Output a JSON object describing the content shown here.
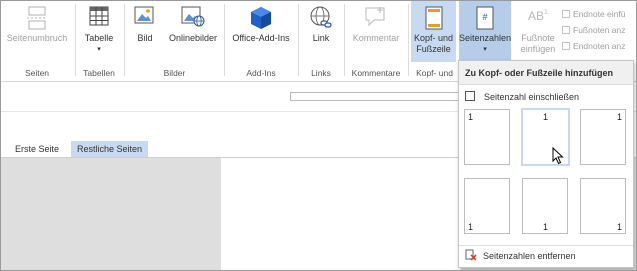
{
  "ribbon": {
    "buttons": {
      "seitenumbruch": "Seitenumbruch",
      "tabelle": "Tabelle",
      "bild": "Bild",
      "onlinebilder": "Onlinebilder",
      "office_addins": "Office-Add-Ins",
      "link": "Link",
      "kommentar": "Kommentar",
      "kopf_line1": "Kopf- und",
      "kopf_line2": "Fußzeile",
      "seitenzahlen": "Seitenzahlen",
      "fussnote_line1": "Fußnote",
      "fussnote_line2": "einfügen",
      "endnote_einfuegen": "Endnote einfü",
      "fussnoten_anzeigen": "Fußnoten anz",
      "endnoten_anzeigen": "Endnoten anz"
    },
    "groups": {
      "seiten": "Seiten",
      "tabellen": "Tabellen",
      "bilder": "Bilder",
      "addins": "Add-Ins",
      "links": "Links",
      "kommentare": "Kommentare",
      "kopf_fusszeile": "Kopf- und"
    }
  },
  "tabs": {
    "erste_seite": "Erste Seite",
    "restliche_seiten": "Restliche Seiten"
  },
  "dropdown": {
    "title": "Zu Kopf- oder Fußzeile hinzufügen",
    "checkbox_label": "Seitenzahl einschließen",
    "checkbox_checked": false,
    "thumb_number": "1",
    "remove_label": "Seitenzahlen entfernen"
  },
  "colors": {
    "highlight": "#c8daf2",
    "accent_blue": "#2b579a",
    "addins_icon": "#1e62c8",
    "remove_red": "#d9342b"
  },
  "icons": {
    "seitenumbruch": "page-break-icon",
    "tabelle": "table-icon",
    "bild": "picture-icon",
    "onlinebilder": "online-pictures-icon",
    "office_addins": "office-addins-icon",
    "link": "link-icon",
    "kommentar": "comment-icon",
    "kopf": "header-footer-icon",
    "seitenzahlen": "page-number-icon",
    "fussnote": "footnote-icon",
    "remove": "remove-page-numbers-icon"
  }
}
